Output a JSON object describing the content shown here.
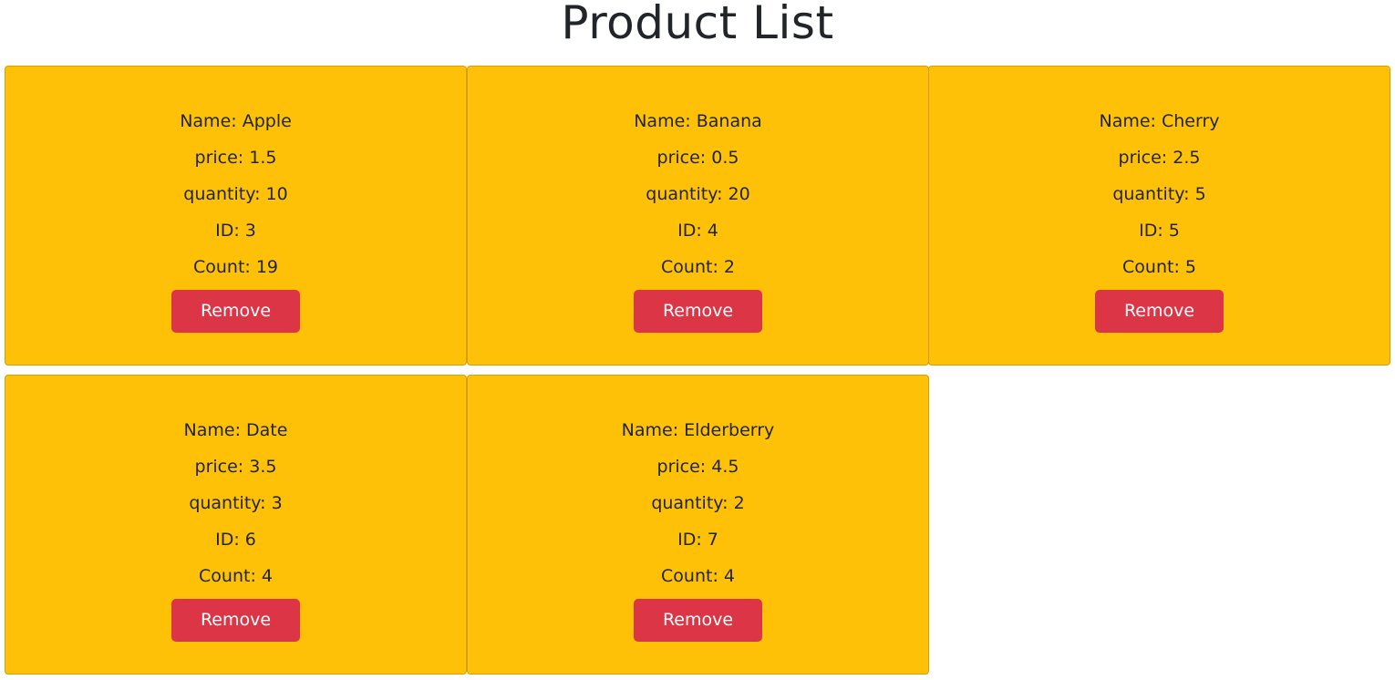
{
  "page": {
    "title": "Product List"
  },
  "labels": {
    "name": "Name: ",
    "price": "price: ",
    "quantity": "quantity: ",
    "id": "ID: ",
    "count": "Count: ",
    "remove": "Remove"
  },
  "products": [
    {
      "name": "Apple",
      "price": "1.5",
      "quantity": "10",
      "id": "3",
      "count": "19"
    },
    {
      "name": "Banana",
      "price": "0.5",
      "quantity": "20",
      "id": "4",
      "count": "2"
    },
    {
      "name": "Cherry",
      "price": "2.5",
      "quantity": "5",
      "id": "5",
      "count": "5"
    },
    {
      "name": "Date",
      "price": "3.5",
      "quantity": "3",
      "id": "6",
      "count": "4"
    },
    {
      "name": "Elderberry",
      "price": "4.5",
      "quantity": "2",
      "id": "7",
      "count": "4"
    }
  ],
  "colors": {
    "card_bg": "#ffc107",
    "remove_button": "#dc3545"
  }
}
